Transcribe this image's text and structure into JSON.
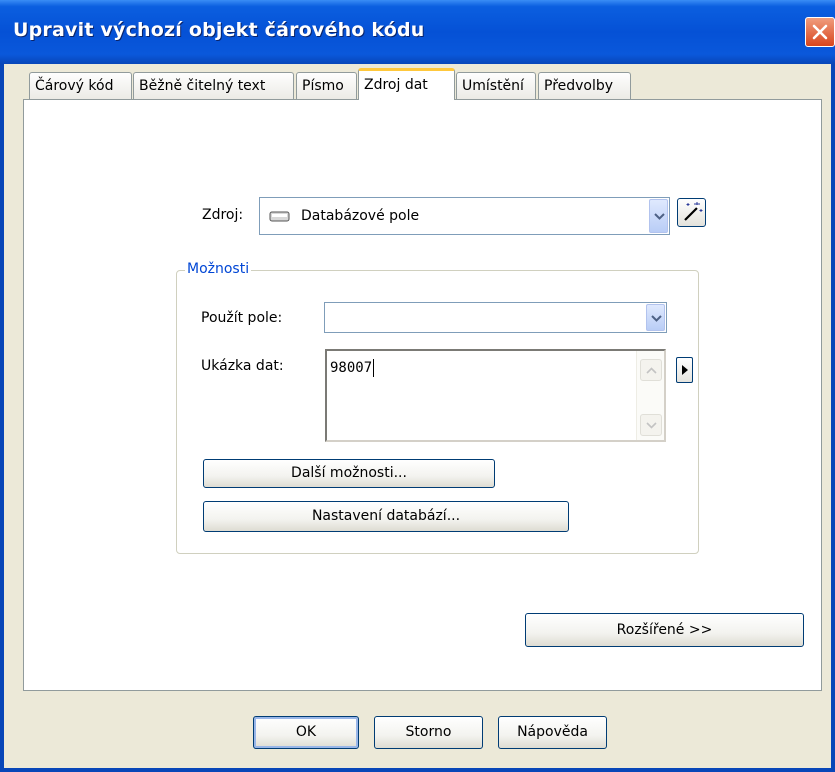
{
  "window": {
    "title": "Upravit výchozí objekt čárového kódu"
  },
  "tabs": [
    {
      "label": "Čárový kód"
    },
    {
      "label": "Běžně čitelný text"
    },
    {
      "label": "Písmo"
    },
    {
      "label": "Zdroj dat",
      "active": true
    },
    {
      "label": "Umístění"
    },
    {
      "label": "Předvolby"
    }
  ],
  "source": {
    "label": "Zdroj:",
    "value": "Databázové pole",
    "icon": "database-field-icon"
  },
  "options": {
    "group_label": "Možnosti",
    "use_field_label": "Použít pole:",
    "use_field_value": "",
    "sample_label": "Ukázka dat:",
    "sample_value": "98007",
    "more_options_button": "Další možnosti...",
    "db_settings_button": "Nastavení databází..."
  },
  "advanced_button": "Rozšířené >>",
  "footer": {
    "ok": "OK",
    "cancel": "Storno",
    "help": "Nápověda"
  },
  "colors": {
    "titlebar": "#0551d6",
    "active_tab_accent": "#ffc83c",
    "group_label": "#0046d5",
    "close": "#d8451e"
  }
}
